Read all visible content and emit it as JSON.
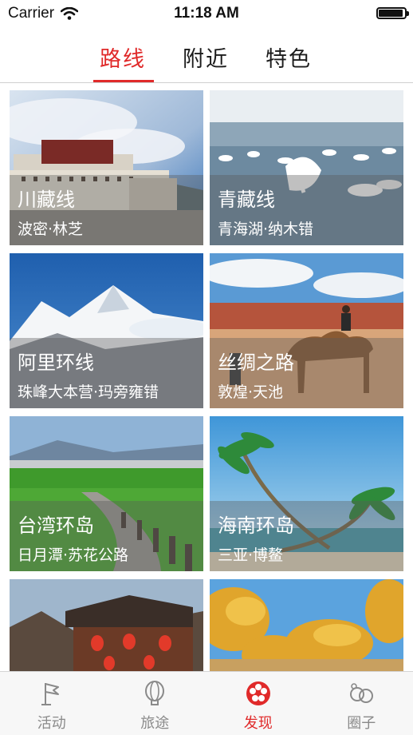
{
  "status_bar": {
    "carrier": "Carrier",
    "time": "11:18 AM",
    "battery_level": 0.95
  },
  "top_tabs": [
    {
      "label": "路线",
      "active": true
    },
    {
      "label": "附近",
      "active": false
    },
    {
      "label": "特色",
      "active": false
    }
  ],
  "cards": [
    {
      "title": "川藏线",
      "subtitle": "波密·林芝"
    },
    {
      "title": "青藏线",
      "subtitle": "青海湖·纳木错"
    },
    {
      "title": "阿里环线",
      "subtitle": "珠峰大本营·玛旁雍错"
    },
    {
      "title": "丝绸之路",
      "subtitle": "敦煌·天池"
    },
    {
      "title": "台湾环岛",
      "subtitle": "日月潭·苏花公路"
    },
    {
      "title": "海南环岛",
      "subtitle": "三亚·博鳌"
    }
  ],
  "tab_bar": [
    {
      "label": "活动",
      "icon": "flag-icon",
      "active": false
    },
    {
      "label": "旅途",
      "icon": "balloon-icon",
      "active": false
    },
    {
      "label": "发现",
      "icon": "discover-icon",
      "active": true
    },
    {
      "label": "圈子",
      "icon": "circles-icon",
      "active": false
    }
  ],
  "colors": {
    "accent": "#e02a2a",
    "inactive": "#8a8a8a"
  }
}
